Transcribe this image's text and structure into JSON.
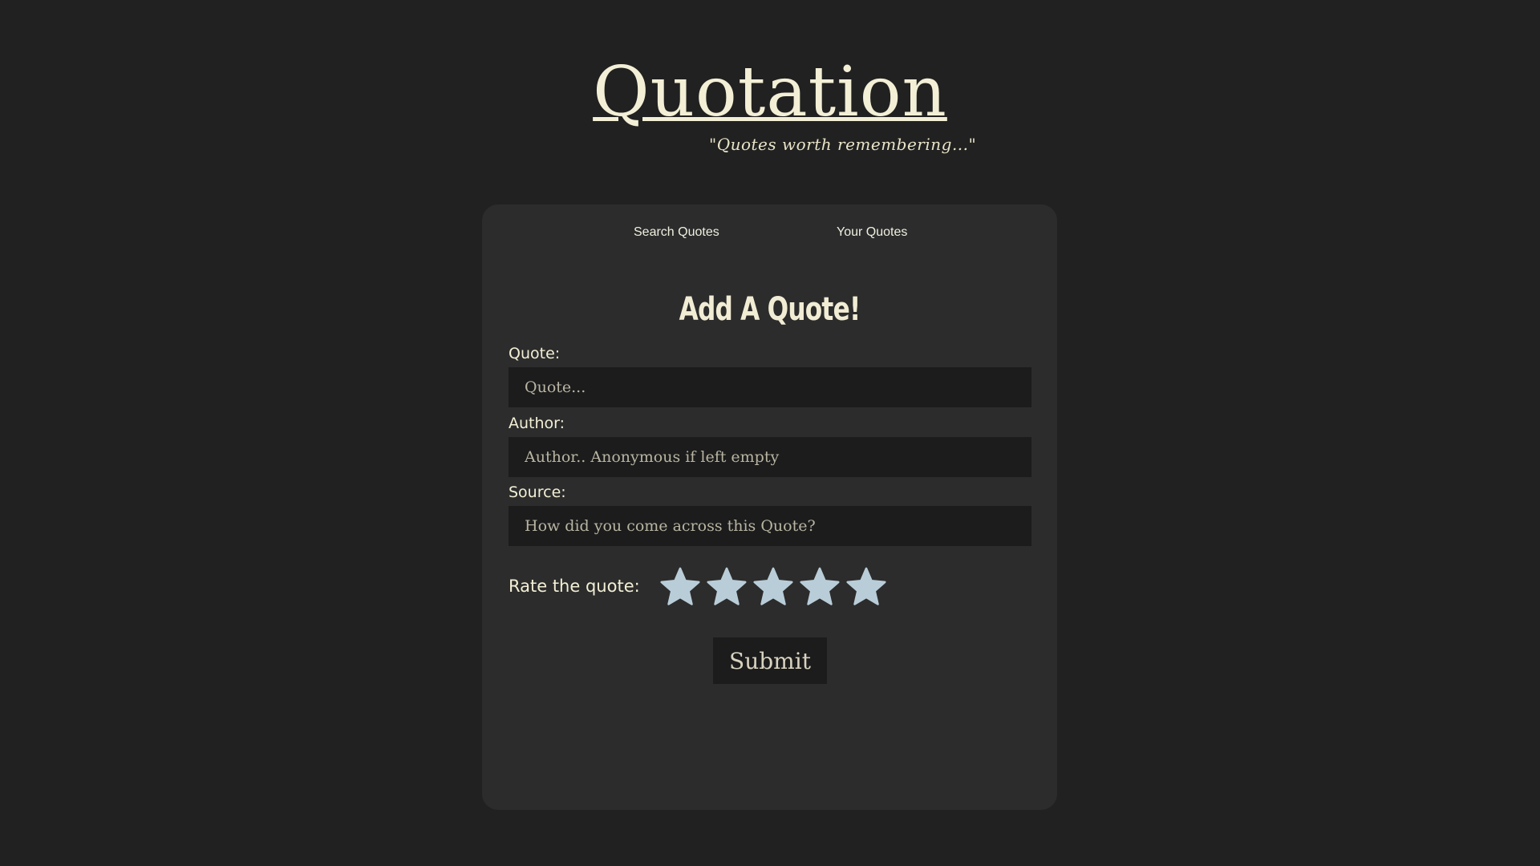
{
  "header": {
    "logo_text": "Quotation",
    "tagline": "\"Quotes worth remembering...\""
  },
  "nav": {
    "items": [
      {
        "label": "Search Quotes"
      },
      {
        "label": "Your Quotes"
      }
    ]
  },
  "form": {
    "title": "Add A Quote!",
    "quote": {
      "label": "Quote:",
      "placeholder": "Quote...",
      "value": ""
    },
    "author": {
      "label": "Author:",
      "placeholder": "Author.. Anonymous if left empty",
      "value": ""
    },
    "source": {
      "label": "Source:",
      "placeholder": "How did you come across this Quote?",
      "value": ""
    },
    "rating": {
      "label": "Rate the quote:",
      "max": 5,
      "value": 0,
      "star_icon": "star-icon"
    },
    "submit_label": "Submit"
  },
  "colors": {
    "background": "#212121",
    "card": "#2c2c2c",
    "input": "#1c1c1c",
    "text": "#f3efd6",
    "star": "#b9cdd8"
  }
}
